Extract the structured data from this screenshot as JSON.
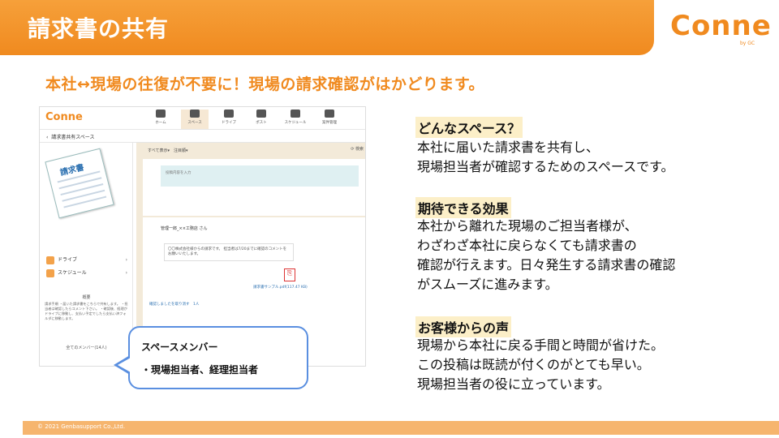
{
  "header": {
    "title": "請求書の共有",
    "brand": "Conne",
    "brand_sub": "by GC"
  },
  "subtitle": "本社↔現場の往復が不要に！現場の請求確認がはかどります。",
  "screenshot": {
    "logo": "Conne",
    "nav": [
      "ホーム",
      "スペース",
      "ドライブ",
      "ポスト",
      "スケジュール",
      "案件管理"
    ],
    "breadcrumb": "請求書共有スペース",
    "invoice_title": "請求書",
    "left_menu": [
      "ドライブ",
      "スケジュール"
    ],
    "summary_heading": "概要",
    "summary_text": "請求手順 ・届いた請求書をこちらで共有します。 ・担当者は確認したらコメント下さい。 ・確認後、経理がドライブに移動し、支払い予定でしたら支払い済フォルダに移動します。",
    "members_heading": "全てのメンバー(14人)",
    "filter": "すべて表示▾　注目順▾",
    "search": "検索",
    "post_placeholder": "投稿内容を入力",
    "post_author": "管理一郎_××工務店 さん",
    "post_message": "〇〇株式会社様からの請求です。 担当者は7/20までに確認のコメントをお願いいたします。",
    "pdf_name": "請求書サンプル.pdf(117.47 KB)",
    "confirm_text": "確認しましたを取り消す　1人"
  },
  "bubble": {
    "line1": "スペースメンバー",
    "line2": "・現場担当者、経理担当者"
  },
  "sections": [
    {
      "heading": "どんなスペース？",
      "lines": [
        "本社に届いた請求書を共有し、",
        "現場担当者が確認するためのスペースです。"
      ]
    },
    {
      "heading": "期待できる効果",
      "lines": [
        "本社から離れた現場のご担当者様が、",
        "わざわざ本社に戻らなくても請求書の",
        "確認が行えます。日々発生する請求書の確認",
        "がスムーズに進みます。"
      ]
    },
    {
      "heading": "お客様からの声",
      "lines": [
        "現場から本社に戻る手間と時間が省けた。",
        "この投稿は既読が付くのがとても早い。",
        "現場担当者の役に立っています。"
      ]
    }
  ],
  "footer": "© 2021 Genbasupport Co.,Ltd."
}
